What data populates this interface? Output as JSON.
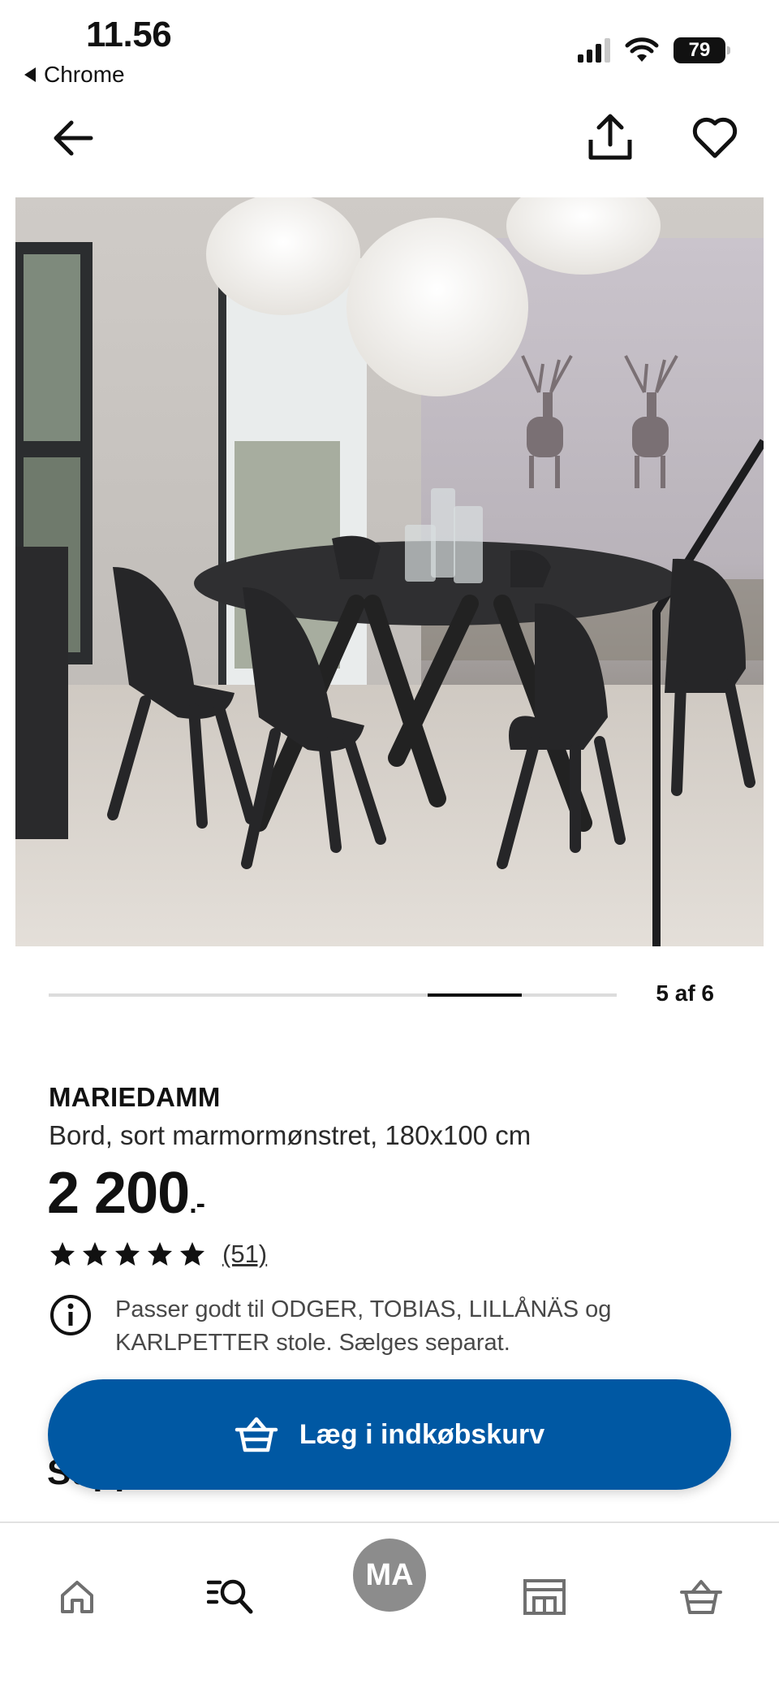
{
  "status_bar": {
    "time": "11.56",
    "back_app": "Chrome",
    "battery": "79"
  },
  "product": {
    "name": "MARIEDAMM",
    "description": "Bord, sort marmormønstret, 180x100 cm",
    "price": "2 200",
    "price_suffix": ".-",
    "rating": {
      "stars": 5,
      "max": 5,
      "count_label": "(51)"
    },
    "info_text": "Passer godt til ODGER, TOBIAS, LILLÅNÄS og KARLPETTER stole. Sælges separat."
  },
  "carousel": {
    "label": "5 af 6",
    "current": 5,
    "total": 6
  },
  "cta": {
    "label": "Læg i indkøbskurv"
  },
  "section_peek": {
    "heading": "Suppleret med"
  },
  "tabbar": {
    "avatar_initials": "MA",
    "items": [
      "home-icon",
      "search-list-icon",
      "avatar",
      "store-icon",
      "basket-icon"
    ]
  },
  "colors": {
    "brand_blue": "#0058a3",
    "text": "#111111",
    "avatar_gray": "#8c8c8c"
  }
}
